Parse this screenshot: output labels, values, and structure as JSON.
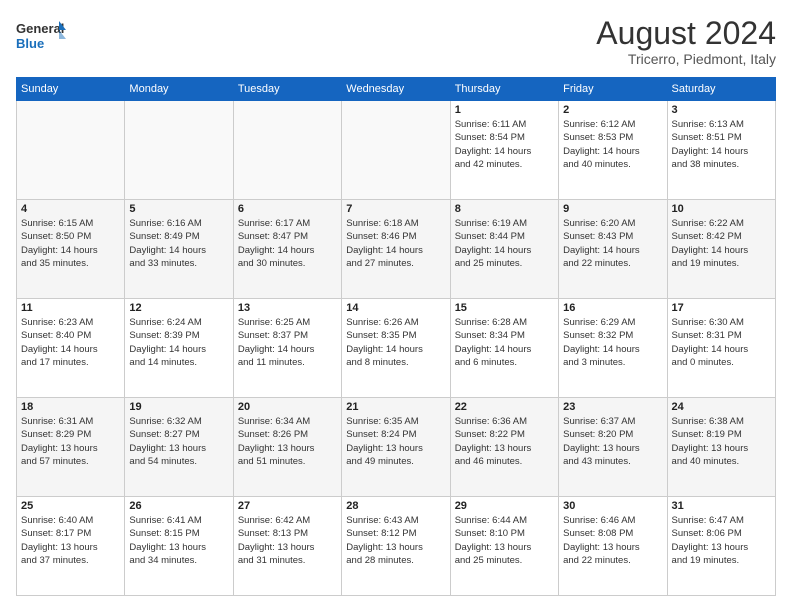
{
  "header": {
    "logo_line1": "General",
    "logo_line2": "Blue",
    "title": "August 2024",
    "subtitle": "Tricerro, Piedmont, Italy"
  },
  "days_of_week": [
    "Sunday",
    "Monday",
    "Tuesday",
    "Wednesday",
    "Thursday",
    "Friday",
    "Saturday"
  ],
  "weeks": [
    [
      {
        "day": "",
        "info": ""
      },
      {
        "day": "",
        "info": ""
      },
      {
        "day": "",
        "info": ""
      },
      {
        "day": "",
        "info": ""
      },
      {
        "day": "1",
        "info": "Sunrise: 6:11 AM\nSunset: 8:54 PM\nDaylight: 14 hours\nand 42 minutes."
      },
      {
        "day": "2",
        "info": "Sunrise: 6:12 AM\nSunset: 8:53 PM\nDaylight: 14 hours\nand 40 minutes."
      },
      {
        "day": "3",
        "info": "Sunrise: 6:13 AM\nSunset: 8:51 PM\nDaylight: 14 hours\nand 38 minutes."
      }
    ],
    [
      {
        "day": "4",
        "info": "Sunrise: 6:15 AM\nSunset: 8:50 PM\nDaylight: 14 hours\nand 35 minutes."
      },
      {
        "day": "5",
        "info": "Sunrise: 6:16 AM\nSunset: 8:49 PM\nDaylight: 14 hours\nand 33 minutes."
      },
      {
        "day": "6",
        "info": "Sunrise: 6:17 AM\nSunset: 8:47 PM\nDaylight: 14 hours\nand 30 minutes."
      },
      {
        "day": "7",
        "info": "Sunrise: 6:18 AM\nSunset: 8:46 PM\nDaylight: 14 hours\nand 27 minutes."
      },
      {
        "day": "8",
        "info": "Sunrise: 6:19 AM\nSunset: 8:44 PM\nDaylight: 14 hours\nand 25 minutes."
      },
      {
        "day": "9",
        "info": "Sunrise: 6:20 AM\nSunset: 8:43 PM\nDaylight: 14 hours\nand 22 minutes."
      },
      {
        "day": "10",
        "info": "Sunrise: 6:22 AM\nSunset: 8:42 PM\nDaylight: 14 hours\nand 19 minutes."
      }
    ],
    [
      {
        "day": "11",
        "info": "Sunrise: 6:23 AM\nSunset: 8:40 PM\nDaylight: 14 hours\nand 17 minutes."
      },
      {
        "day": "12",
        "info": "Sunrise: 6:24 AM\nSunset: 8:39 PM\nDaylight: 14 hours\nand 14 minutes."
      },
      {
        "day": "13",
        "info": "Sunrise: 6:25 AM\nSunset: 8:37 PM\nDaylight: 14 hours\nand 11 minutes."
      },
      {
        "day": "14",
        "info": "Sunrise: 6:26 AM\nSunset: 8:35 PM\nDaylight: 14 hours\nand 8 minutes."
      },
      {
        "day": "15",
        "info": "Sunrise: 6:28 AM\nSunset: 8:34 PM\nDaylight: 14 hours\nand 6 minutes."
      },
      {
        "day": "16",
        "info": "Sunrise: 6:29 AM\nSunset: 8:32 PM\nDaylight: 14 hours\nand 3 minutes."
      },
      {
        "day": "17",
        "info": "Sunrise: 6:30 AM\nSunset: 8:31 PM\nDaylight: 14 hours\nand 0 minutes."
      }
    ],
    [
      {
        "day": "18",
        "info": "Sunrise: 6:31 AM\nSunset: 8:29 PM\nDaylight: 13 hours\nand 57 minutes."
      },
      {
        "day": "19",
        "info": "Sunrise: 6:32 AM\nSunset: 8:27 PM\nDaylight: 13 hours\nand 54 minutes."
      },
      {
        "day": "20",
        "info": "Sunrise: 6:34 AM\nSunset: 8:26 PM\nDaylight: 13 hours\nand 51 minutes."
      },
      {
        "day": "21",
        "info": "Sunrise: 6:35 AM\nSunset: 8:24 PM\nDaylight: 13 hours\nand 49 minutes."
      },
      {
        "day": "22",
        "info": "Sunrise: 6:36 AM\nSunset: 8:22 PM\nDaylight: 13 hours\nand 46 minutes."
      },
      {
        "day": "23",
        "info": "Sunrise: 6:37 AM\nSunset: 8:20 PM\nDaylight: 13 hours\nand 43 minutes."
      },
      {
        "day": "24",
        "info": "Sunrise: 6:38 AM\nSunset: 8:19 PM\nDaylight: 13 hours\nand 40 minutes."
      }
    ],
    [
      {
        "day": "25",
        "info": "Sunrise: 6:40 AM\nSunset: 8:17 PM\nDaylight: 13 hours\nand 37 minutes."
      },
      {
        "day": "26",
        "info": "Sunrise: 6:41 AM\nSunset: 8:15 PM\nDaylight: 13 hours\nand 34 minutes."
      },
      {
        "day": "27",
        "info": "Sunrise: 6:42 AM\nSunset: 8:13 PM\nDaylight: 13 hours\nand 31 minutes."
      },
      {
        "day": "28",
        "info": "Sunrise: 6:43 AM\nSunset: 8:12 PM\nDaylight: 13 hours\nand 28 minutes."
      },
      {
        "day": "29",
        "info": "Sunrise: 6:44 AM\nSunset: 8:10 PM\nDaylight: 13 hours\nand 25 minutes."
      },
      {
        "day": "30",
        "info": "Sunrise: 6:46 AM\nSunset: 8:08 PM\nDaylight: 13 hours\nand 22 minutes."
      },
      {
        "day": "31",
        "info": "Sunrise: 6:47 AM\nSunset: 8:06 PM\nDaylight: 13 hours\nand 19 minutes."
      }
    ]
  ]
}
